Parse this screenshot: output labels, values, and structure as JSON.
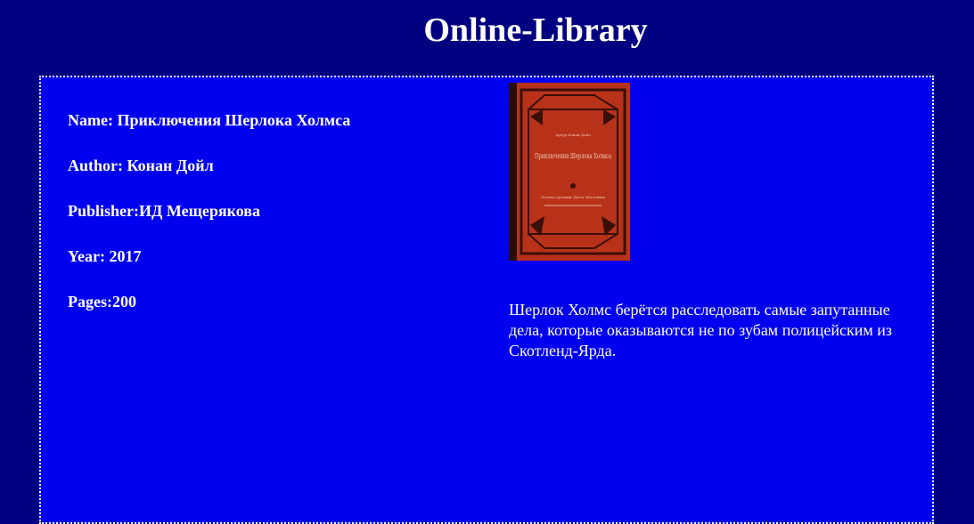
{
  "header": {
    "title": "Online-Library"
  },
  "book": {
    "name_line": "Name: Приключения Шерлока Холмса",
    "author_line": "Author: Конан Дойл",
    "publisher_line": "Publisher:ИД Мещерякова",
    "year_line": "Year: 2017",
    "pages_line": "Pages:200",
    "description": "Шерлок Холмс берётся расследовать самые запутанные дела, которые оказываются не по зубам полицейским из Скотленд-Ярда.",
    "cover": {
      "title_text": "Приключения Шерлока Холмса",
      "author_text": "Артур Конан Дойл",
      "illustrator_text": "Иллюстрации Дега Матейки"
    }
  },
  "colors": {
    "page_background": "#000080",
    "panel_background": "#0000ee",
    "text": "#ffffff",
    "cover_red": "#b8321a",
    "cover_dark": "#2a0d08"
  }
}
